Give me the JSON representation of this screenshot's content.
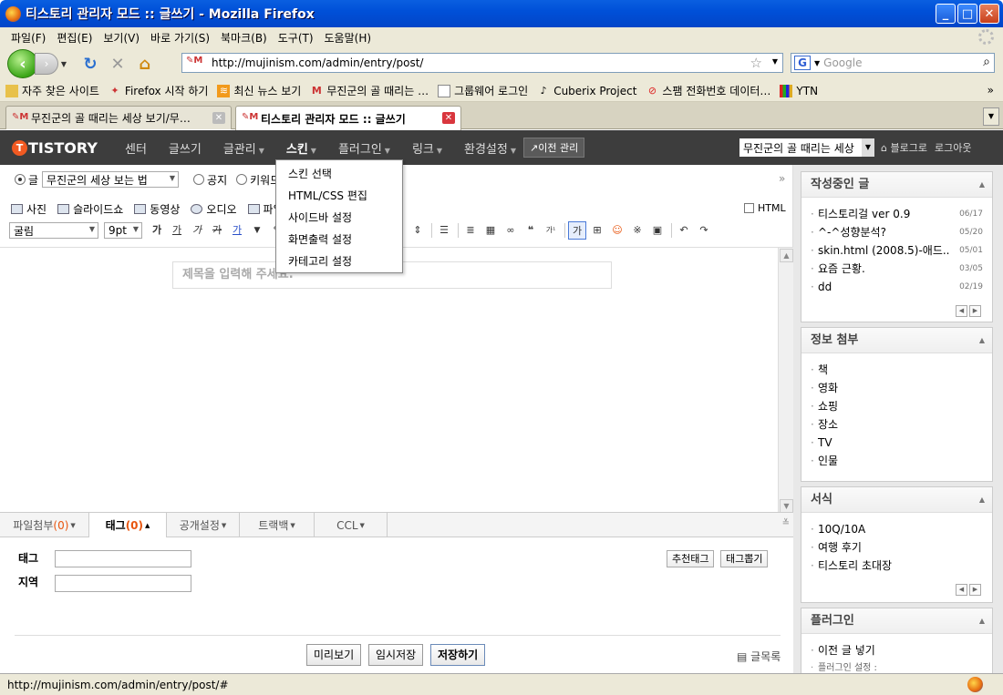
{
  "window": {
    "title": "티스토리 관리자 모드 :: 글쓰기 - Mozilla Firefox",
    "minimize": "_",
    "maximize": "□",
    "close": "✕"
  },
  "menubar": [
    "파일(F)",
    "편집(E)",
    "보기(V)",
    "바로 가기(S)",
    "북마크(B)",
    "도구(T)",
    "도움말(H)"
  ],
  "toolbar": {
    "url": "http://mujinism.com/admin/entry/post/",
    "search_placeholder": "Google"
  },
  "bookmarks": [
    {
      "label": "자주 찾은 사이트",
      "icon": "folder-icon"
    },
    {
      "label": "Firefox 시작 하기",
      "icon": "firefox-icon"
    },
    {
      "label": "최신 뉴스 보기",
      "icon": "rss-icon"
    },
    {
      "label": "무진군의 골 때리는 …",
      "icon": "site-icon"
    },
    {
      "label": "그룹웨어 로그인",
      "icon": "page-icon"
    },
    {
      "label": "Cuberix Project",
      "icon": "music-icon"
    },
    {
      "label": "스팸 전화번호 데이터…",
      "icon": "noentry-icon"
    },
    {
      "label": "YTN",
      "icon": "bars-icon"
    }
  ],
  "tabs": [
    {
      "label": "무진군의 골 때리는 세상 보기/무…",
      "active": false
    },
    {
      "label": "티스토리 관리자 모드 :: 글쓰기",
      "active": true
    }
  ],
  "tistory_nav": {
    "logo": "TISTORY",
    "items": [
      "센터",
      "글쓰기",
      "글관리",
      "스킨",
      "플러그인",
      "링크",
      "환경설정"
    ],
    "old_admin": "↗이전 관리",
    "blog_select": "무진군의 골 때리는 세상",
    "blog_link": "블로그로",
    "logout": "로그아웃"
  },
  "skin_menu": [
    "스킨 선택",
    "HTML/CSS 편집",
    "사이드바 설정",
    "화면출력 설정",
    "카테고리 설정"
  ],
  "editor": {
    "type_post": "글",
    "category": "무진군의 세상 보는 법",
    "type_notice": "공지",
    "type_keyword": "키워드",
    "media": [
      "사진",
      "슬라이드쇼",
      "동영상",
      "오디오",
      "파일"
    ],
    "html_label": "HTML",
    "font": "굴림",
    "size": "9pt",
    "title_placeholder": "제목을 입력해 주세요."
  },
  "bottom_tabs": [
    {
      "label": "파일첨부",
      "count": "(0)"
    },
    {
      "label": "태그",
      "count": "(0)"
    },
    {
      "label": "공개설정",
      "count": ""
    },
    {
      "label": "트랙백",
      "count": ""
    },
    {
      "label": "CCL",
      "count": ""
    }
  ],
  "tag_panel": {
    "tag_label": "태그",
    "location_label": "지역",
    "recommend": "추천태그",
    "extract": "태그뽑기"
  },
  "actions": {
    "preview": "미리보기",
    "draft": "임시저장",
    "save": "저장하기",
    "list": "글목록"
  },
  "sidebar": {
    "drafts": {
      "title": "작성중인 글",
      "items": [
        {
          "label": "티스토리걸 ver 0.9",
          "date": "06/17"
        },
        {
          "label": "^-^성향분석?",
          "date": "05/20"
        },
        {
          "label": "skin.html (2008.5)-애드..",
          "date": "05/01"
        },
        {
          "label": "요즘 근황.",
          "date": "03/05"
        },
        {
          "label": "dd",
          "date": "02/19"
        }
      ]
    },
    "info": {
      "title": "정보 첨부",
      "items": [
        "책",
        "영화",
        "쇼핑",
        "장소",
        "TV",
        "인물"
      ]
    },
    "forms": {
      "title": "서식",
      "items": [
        "10Q/10A",
        "여행 후기",
        "티스토리 초대장"
      ]
    },
    "plugins": {
      "title": "플러그인",
      "items": [
        "이전 글 넣기",
        "플러그인 설정 :"
      ]
    }
  },
  "status": "http://mujinism.com/admin/entry/post/#"
}
